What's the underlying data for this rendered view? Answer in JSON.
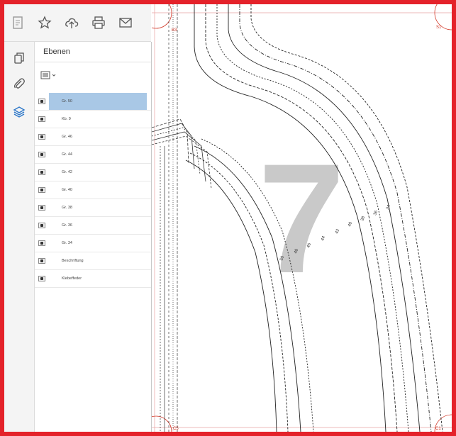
{
  "toolbar": {
    "items": [
      {
        "name": "document-icon"
      },
      {
        "name": "star-icon"
      },
      {
        "name": "upload-cloud-icon"
      },
      {
        "name": "print-icon"
      },
      {
        "name": "mail-icon"
      }
    ]
  },
  "rail": {
    "items": [
      {
        "name": "pages-icon"
      },
      {
        "name": "paperclip-icon"
      },
      {
        "name": "layers-icon",
        "active": true
      }
    ]
  },
  "panel": {
    "title": "Ebenen",
    "layers": [
      {
        "label": "Gr. 50",
        "selected": true
      },
      {
        "label": "Kb. 9"
      },
      {
        "label": "Gr. 46"
      },
      {
        "label": "Gr. 44"
      },
      {
        "label": "Gr. 42"
      },
      {
        "label": "Gr. 40"
      },
      {
        "label": "Gr. 38"
      },
      {
        "label": "Gr. 36"
      },
      {
        "label": "Gr. 34"
      },
      {
        "label": "Beschriftung"
      },
      {
        "label": "Klebeffeder"
      }
    ]
  },
  "document": {
    "page_marker": "7",
    "corner_labels": {
      "top_left": "B3",
      "top_right": "S1",
      "bottom_left": "C5",
      "bottom_right": "C1"
    },
    "size_labels": [
      "50",
      "48",
      "46",
      "44",
      "42",
      "40",
      "38",
      "36",
      "34"
    ]
  },
  "colors": {
    "frame": "#e4222a",
    "selection": "#a9c8e6",
    "accent": "#2c77c9"
  }
}
